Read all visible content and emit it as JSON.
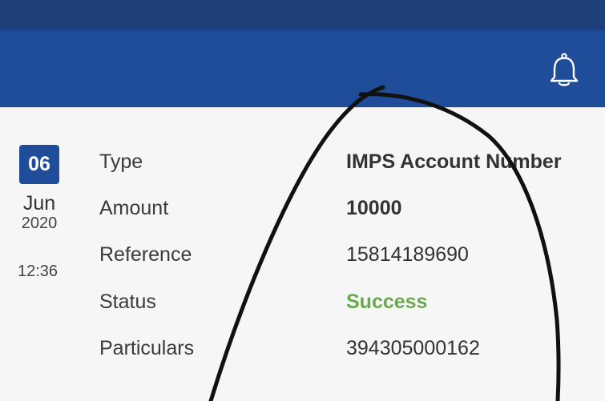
{
  "header": {
    "notification_icon": "bell-icon"
  },
  "date": {
    "day": "06",
    "month": "Jun",
    "year": "2020",
    "time": "12:36"
  },
  "details": {
    "type_label": "Type",
    "type_value": "IMPS Account Number",
    "amount_label": "Amount",
    "amount_value": "10000",
    "reference_label": "Reference",
    "reference_value": "15814189690",
    "status_label": "Status",
    "status_value": "Success",
    "particulars_label": "Particulars",
    "particulars_value": "394305000162"
  },
  "colors": {
    "header": "#1f4d99",
    "status_bar": "#1f3f7a",
    "success": "#6aaa4c",
    "badge": "#1f4d99"
  }
}
